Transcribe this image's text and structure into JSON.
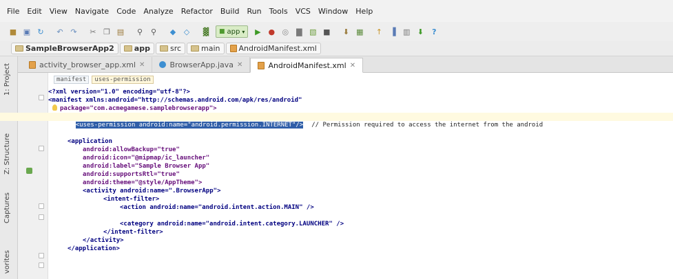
{
  "menubar": {
    "items": [
      "File",
      "Edit",
      "View",
      "Navigate",
      "Code",
      "Analyze",
      "Refactor",
      "Build",
      "Run",
      "Tools",
      "VCS",
      "Window",
      "Help"
    ]
  },
  "toolbar": {
    "run_config_label": "app",
    "icons": [
      "open-icon",
      "save-icon",
      "sync-icon",
      "undo-icon",
      "redo-icon",
      "cut-icon",
      "copy-icon",
      "paste-icon",
      "find-icon",
      "replace-icon",
      "back-icon",
      "forward-icon",
      "make-project-icon",
      "run-config-icon",
      "run-icon",
      "debug-icon",
      "attach-debugger-icon",
      "coverage-icon",
      "gradle-sync-icon",
      "stop-icon",
      "sdk-manager-icon",
      "avd-manager-icon",
      "android-monitor-icon",
      "project-structure-icon",
      "download-icon",
      "help-icon"
    ]
  },
  "breadcrumb": {
    "items": [
      "SampleBrowserApp2",
      "app",
      "src",
      "main",
      "AndroidManifest.xml"
    ]
  },
  "tabs": [
    {
      "label": "activity_browser_app.xml",
      "active": false,
      "icon": "xml-file-icon"
    },
    {
      "label": "BrowserApp.java",
      "active": false,
      "icon": "java-class-icon"
    },
    {
      "label": "AndroidManifest.xml",
      "active": true,
      "icon": "manifest-file-icon"
    }
  ],
  "left_stripe": {
    "labels": [
      "1: Project",
      "Z: Structure",
      "Captures",
      "vorites"
    ]
  },
  "editor": {
    "breadcrumbs": [
      "manifest",
      "uses-permission"
    ],
    "lines": {
      "l1": "<?xml version=\"1.0\" encoding=\"utf-8\"?>",
      "l2": "<manifest xmlns:android=\"http://schemas.android.com/apk/res/android\"",
      "l3": "package=\"com.acmegamese.samplebrowserapp\">",
      "l4_selected": "<uses-permission android:name=\"android.permission.INTERNET\"/>",
      "l4_comment": "// Permission required to access the internet from the android",
      "l6": "<application",
      "l7": "android:allowBackup=\"true\"",
      "l8": "android:icon=\"@mipmap/ic_launcher\"",
      "l9": "android:label=\"Sample Browser App\"",
      "l10": "android:supportsRtl=\"true\"",
      "l11": "android:theme=\"@style/AppTheme\">",
      "l12": "<activity android:name=\".BrowserApp\">",
      "l13": "<intent-filter>",
      "l14": "<action android:name=\"android.intent.action.MAIN\" />",
      "l16": "<category android:name=\"android.intent.category.LAUNCHER\" />",
      "l17": "</intent-filter>",
      "l18": "</activity>",
      "l19": "</application>"
    }
  },
  "colors": {
    "selection": "#2f5ea8",
    "caret_line": "#fffae0",
    "tag": "#000080",
    "attribute_value": "#008000"
  }
}
